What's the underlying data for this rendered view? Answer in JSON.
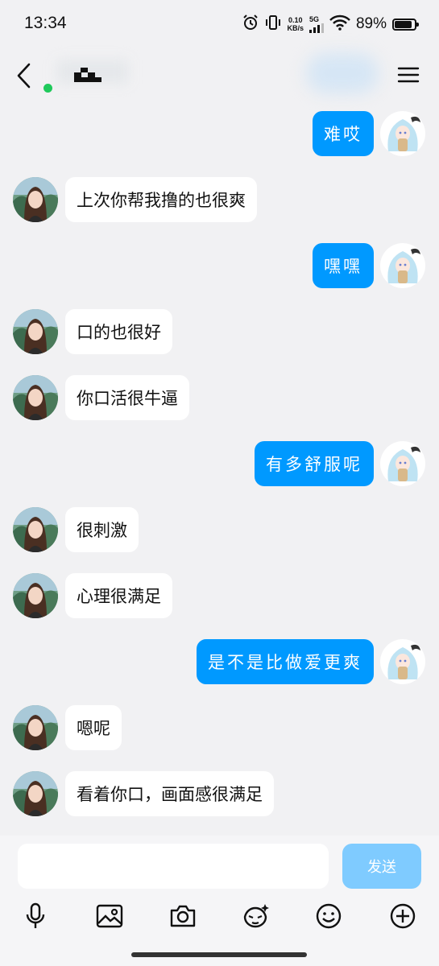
{
  "status": {
    "time": "13:34",
    "net_speed_value": "0.10",
    "net_speed_unit": "KB/s",
    "network_type": "5G",
    "battery": "89%",
    "battery_level": 0.89
  },
  "header": {
    "contact_name": "",
    "presence": ""
  },
  "messages": [
    {
      "side": "right",
      "text": "难哎"
    },
    {
      "side": "left",
      "text": "上次你帮我撸的也很爽"
    },
    {
      "side": "right",
      "text": "嘿嘿"
    },
    {
      "side": "left",
      "text": "口的也很好"
    },
    {
      "side": "left",
      "text": "你口活很牛逼"
    },
    {
      "side": "right",
      "text": "有多舒服呢"
    },
    {
      "side": "left",
      "text": "很刺激"
    },
    {
      "side": "left",
      "text": "心理很满足"
    },
    {
      "side": "right",
      "text": "是不是比做爱更爽"
    },
    {
      "side": "left",
      "text": "嗯呢"
    },
    {
      "side": "left",
      "text": "看着你口，画面感很满足"
    }
  ],
  "composer": {
    "input_value": "",
    "send_label": "发送"
  },
  "colors": {
    "sent_bubble": "#0099ff",
    "received_bubble": "#ffffff",
    "send_button": "#7fcbff",
    "background": "#f1f1f3"
  }
}
